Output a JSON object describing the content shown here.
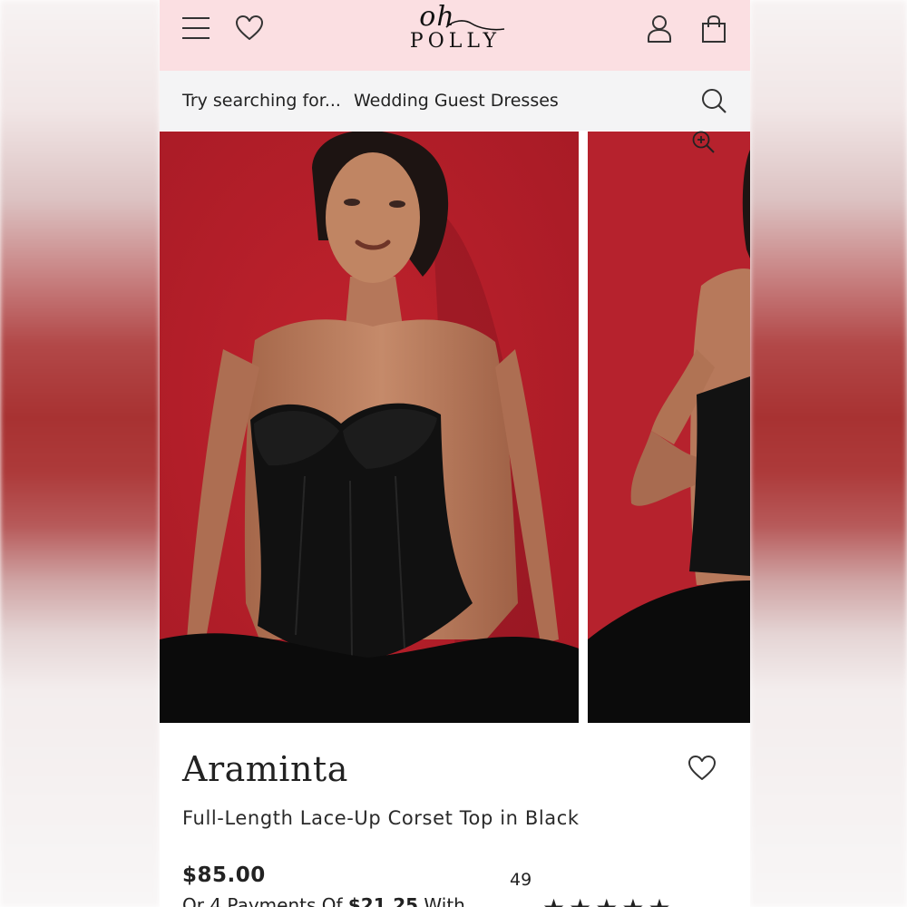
{
  "header": {
    "brand_top": "oh",
    "brand_bottom": "POLLY",
    "menu_icon": "menu-icon",
    "wishlist_icon": "heart-icon",
    "account_icon": "user-icon",
    "bag_icon": "shopping-bag-icon",
    "background_color": "#fbdfe2"
  },
  "search": {
    "hint": "Try searching for...",
    "suggestion": "Wedding Guest Dresses",
    "icon": "search-icon"
  },
  "gallery": {
    "zoom_icon": "zoom-in-icon",
    "backdrop_color": "#b3212c"
  },
  "product": {
    "name": "Araminta",
    "subtitle": "Full-Length Lace-Up Corset Top in Black",
    "price": "$85.00",
    "installments_prefix": "Or 4 Payments Of ",
    "installments_amount": "$21.25",
    "installments_suffix": " With",
    "review_count": "49",
    "rating": 5,
    "max_rating": 5
  }
}
